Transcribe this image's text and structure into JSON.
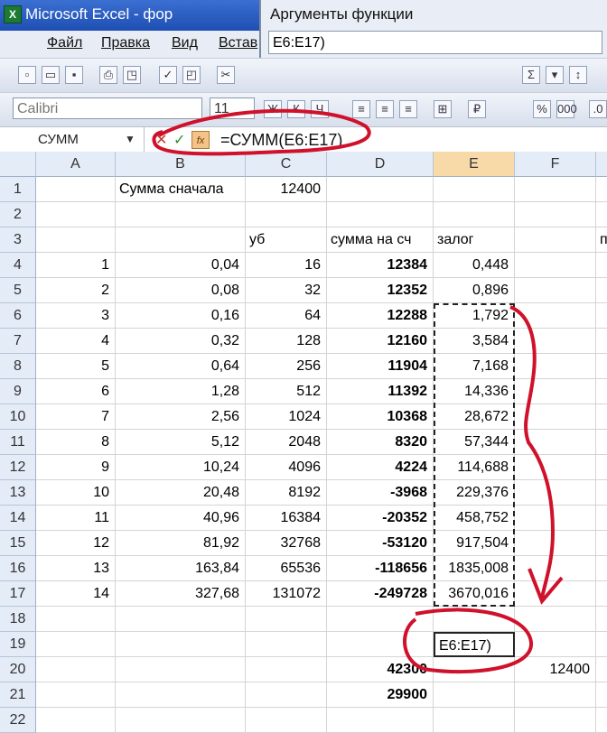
{
  "window": {
    "title": "Microsoft Excel - фор"
  },
  "dialog": {
    "title": "Аргументы функции",
    "input_value": "E6:E17)"
  },
  "menu": {
    "items": [
      "Файл",
      "Правка",
      "Вид",
      "Встав"
    ]
  },
  "toolbar": {
    "font_name": "Calibri",
    "font_size": "11"
  },
  "formula_bar": {
    "name_box": "СУММ",
    "formula": "=СУММ(E6:E17)",
    "fx_label": "fx"
  },
  "sheet": {
    "columns": [
      "A",
      "B",
      "C",
      "D",
      "E",
      "F"
    ],
    "active_column": "E",
    "rows": [
      {
        "n": "1",
        "a": "",
        "b": "Сумма сначала",
        "c": "12400",
        "d": "",
        "e": "",
        "f": ""
      },
      {
        "n": "2",
        "a": "",
        "b": "",
        "c": "",
        "d": "",
        "e": "",
        "f": ""
      },
      {
        "n": "3",
        "a": "",
        "b": "",
        "c": "уб",
        "d": "сумма на сч",
        "e": "залог",
        "f": "",
        "g": "п"
      },
      {
        "n": "4",
        "a": "1",
        "b": "0,04",
        "c": "16",
        "d": "12384",
        "e": "0,448",
        "f": ""
      },
      {
        "n": "5",
        "a": "2",
        "b": "0,08",
        "c": "32",
        "d": "12352",
        "e": "0,896",
        "f": ""
      },
      {
        "n": "6",
        "a": "3",
        "b": "0,16",
        "c": "64",
        "d": "12288",
        "e": "1,792",
        "f": ""
      },
      {
        "n": "7",
        "a": "4",
        "b": "0,32",
        "c": "128",
        "d": "12160",
        "e": "3,584",
        "f": ""
      },
      {
        "n": "8",
        "a": "5",
        "b": "0,64",
        "c": "256",
        "d": "11904",
        "e": "7,168",
        "f": ""
      },
      {
        "n": "9",
        "a": "6",
        "b": "1,28",
        "c": "512",
        "d": "11392",
        "e": "14,336",
        "f": ""
      },
      {
        "n": "10",
        "a": "7",
        "b": "2,56",
        "c": "1024",
        "d": "10368",
        "e": "28,672",
        "f": ""
      },
      {
        "n": "11",
        "a": "8",
        "b": "5,12",
        "c": "2048",
        "d": "8320",
        "e": "57,344",
        "f": ""
      },
      {
        "n": "12",
        "a": "9",
        "b": "10,24",
        "c": "4096",
        "d": "4224",
        "e": "114,688",
        "f": ""
      },
      {
        "n": "13",
        "a": "10",
        "b": "20,48",
        "c": "8192",
        "d": "-3968",
        "e": "229,376",
        "f": ""
      },
      {
        "n": "14",
        "a": "11",
        "b": "40,96",
        "c": "16384",
        "d": "-20352",
        "e": "458,752",
        "f": ""
      },
      {
        "n": "15",
        "a": "12",
        "b": "81,92",
        "c": "32768",
        "d": "-53120",
        "e": "917,504",
        "f": ""
      },
      {
        "n": "16",
        "a": "13",
        "b": "163,84",
        "c": "65536",
        "d": "-118656",
        "e": "1835,008",
        "f": ""
      },
      {
        "n": "17",
        "a": "14",
        "b": "327,68",
        "c": "131072",
        "d": "-249728",
        "e": "3670,016",
        "f": ""
      },
      {
        "n": "18",
        "a": "",
        "b": "",
        "c": "",
        "d": "",
        "e": "",
        "f": ""
      },
      {
        "n": "19",
        "a": "",
        "b": "",
        "c": "",
        "d": "",
        "e": "E6:E17)",
        "f": ""
      },
      {
        "n": "20",
        "a": "",
        "b": "",
        "c": "",
        "d": "42300",
        "e": "",
        "f": "12400"
      },
      {
        "n": "21",
        "a": "",
        "b": "",
        "c": "",
        "d": "29900",
        "e": "",
        "f": ""
      },
      {
        "n": "22",
        "a": "",
        "b": "",
        "c": "",
        "d": "",
        "e": "",
        "f": ""
      }
    ]
  },
  "icons": [
    "excel-logo-icon",
    "new-icon",
    "open-icon",
    "save-icon",
    "print-icon",
    "align-left-icon",
    "align-center-icon",
    "sum-icon",
    "percent-icon"
  ],
  "colors": {
    "title_bar": "#2a5bc4",
    "annotation_red": "#d0112b",
    "active_header": "#f8d9a8"
  }
}
